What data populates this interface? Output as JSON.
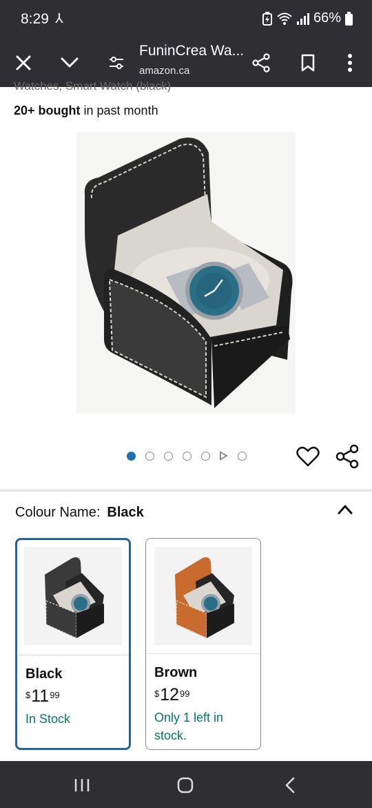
{
  "status": {
    "time": "8:29",
    "battery": "66%"
  },
  "browser": {
    "page_title": "FuninCrea Wa...",
    "url": "amazon.ca"
  },
  "product": {
    "title_fragment": "Watches, Smart Watch (black)",
    "bought_bold": "20+ bought",
    "bought_rest": " in past month",
    "image_count": 7,
    "active_image_index": 0
  },
  "colour": {
    "label": "Colour Name:",
    "selected": "Black",
    "options": [
      {
        "name": "Black",
        "currency": "$",
        "whole": "11",
        "fraction": "99",
        "stock": "In Stock",
        "box_color": "#3a3a3a"
      },
      {
        "name": "Brown",
        "currency": "$",
        "whole": "12",
        "fraction": "99",
        "stock": "Only 1 left in stock.",
        "box_color": "#c96a2e"
      }
    ]
  },
  "colors": {
    "accent": "#2162a1",
    "dot_active": "#1f6fb2",
    "stock_green": "#007a5e",
    "chrome": "#2f2f33"
  }
}
